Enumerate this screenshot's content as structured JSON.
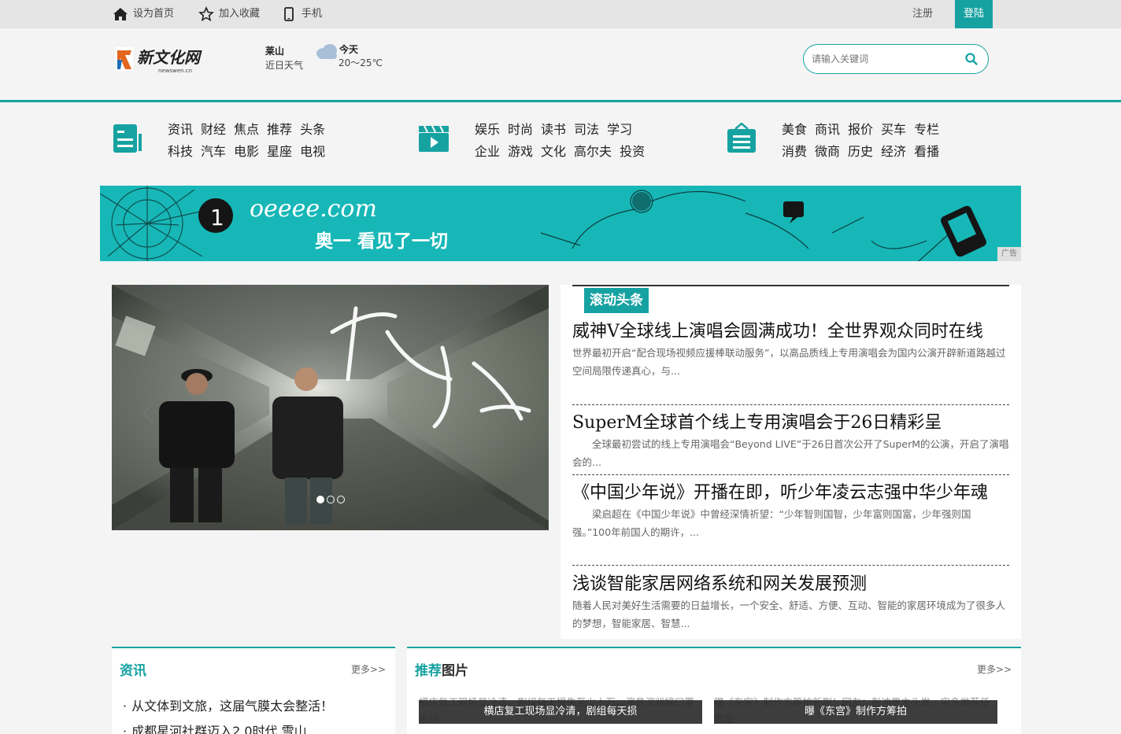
{
  "topbar": {
    "set_home": "设为首页",
    "add_fav": "加入收藏",
    "mobile": "手机",
    "register": "注册",
    "login": "登陆"
  },
  "header": {
    "logo_text": "新文化网",
    "logo_sub": "newswen.cn",
    "weather_city": "莱山",
    "weather_recent": "近日天气",
    "weather_today": "今天",
    "weather_temp": "20～25℃",
    "search_placeholder": "请输入关键词"
  },
  "nav": [
    {
      "icon": "news-icon",
      "row1": [
        "资讯",
        "财经",
        "焦点",
        "推荐",
        "头条"
      ],
      "row2": [
        "科技",
        "汽车",
        "电影",
        "星座",
        "电视"
      ]
    },
    {
      "icon": "video-icon",
      "row1": [
        "娱乐",
        "时尚",
        "读书",
        "司法",
        "学习"
      ],
      "row2": [
        "企业",
        "游戏",
        "文化",
        "高尔夫",
        "投资"
      ]
    },
    {
      "icon": "clipboard-icon",
      "row1": [
        "美食",
        "商讯",
        "报价",
        "买车",
        "专栏"
      ],
      "row2": [
        "消费",
        "微商",
        "历史",
        "经济",
        "看播"
      ]
    }
  ],
  "banner": {
    "brand": "oeeee.com",
    "slogan": "奥一 看见了一切",
    "ad_label": "广告"
  },
  "headlines": {
    "tag": "滚动头条",
    "items": [
      {
        "title": "威神V全球线上演唱会圆满成功！全世界观众同时在线",
        "desc": "世界最初开启“配合现场视频应援棒联动服务”，以高品质线上专用演唱会为国内公演开辟新道路越过空间局限传递真心，与..."
      },
      {
        "title": "SuperM全球首个线上专用演唱会于26日精彩呈",
        "desc": "　　全球最初尝试的线上专用演唱会“Beyond LIVE”于26日首次公开了SuperM的公演，开启了演唱会的..."
      },
      {
        "title": "《中国少年说》开播在即，听少年凌云志强中华少年魂",
        "desc": "　　梁启超在《中国少年说》中曾经深情祈望：“少年智则国智，少年富则国富，少年强则国强。”100年前国人的期许，..."
      },
      {
        "title": "浅谈智能家居网络系统和网关发展预测",
        "desc": "随着人民对美好生活需要的日益增长，一个安全、舒适、方便、互动、智能的家居环境成为了很多人的梦想，智能家居、智慧..."
      }
    ]
  },
  "news_panel": {
    "title": "资讯",
    "more": "更多>>",
    "items": [
      "从文体到文旅，这届气膜太会整活！",
      "成都星河社群迈入2.0时代 雪山"
    ]
  },
  "pics_panel": {
    "title_hl": "推荐",
    "title_rest": "图片",
    "more": "更多>>",
    "pics": [
      {
        "alt": "横店复工现场显冷清，剧组每天损失至少上万，演员演戏摘口罩说词",
        "caption": "横店复工现场显冷清，剧组每天损"
      },
      {
        "alt": "曝《东宫》制作方筹拍新剧！网友：彭冲男主头发，实多举荐任嘉伦",
        "caption": "曝《东宫》制作方筹拍"
      }
    ]
  }
}
